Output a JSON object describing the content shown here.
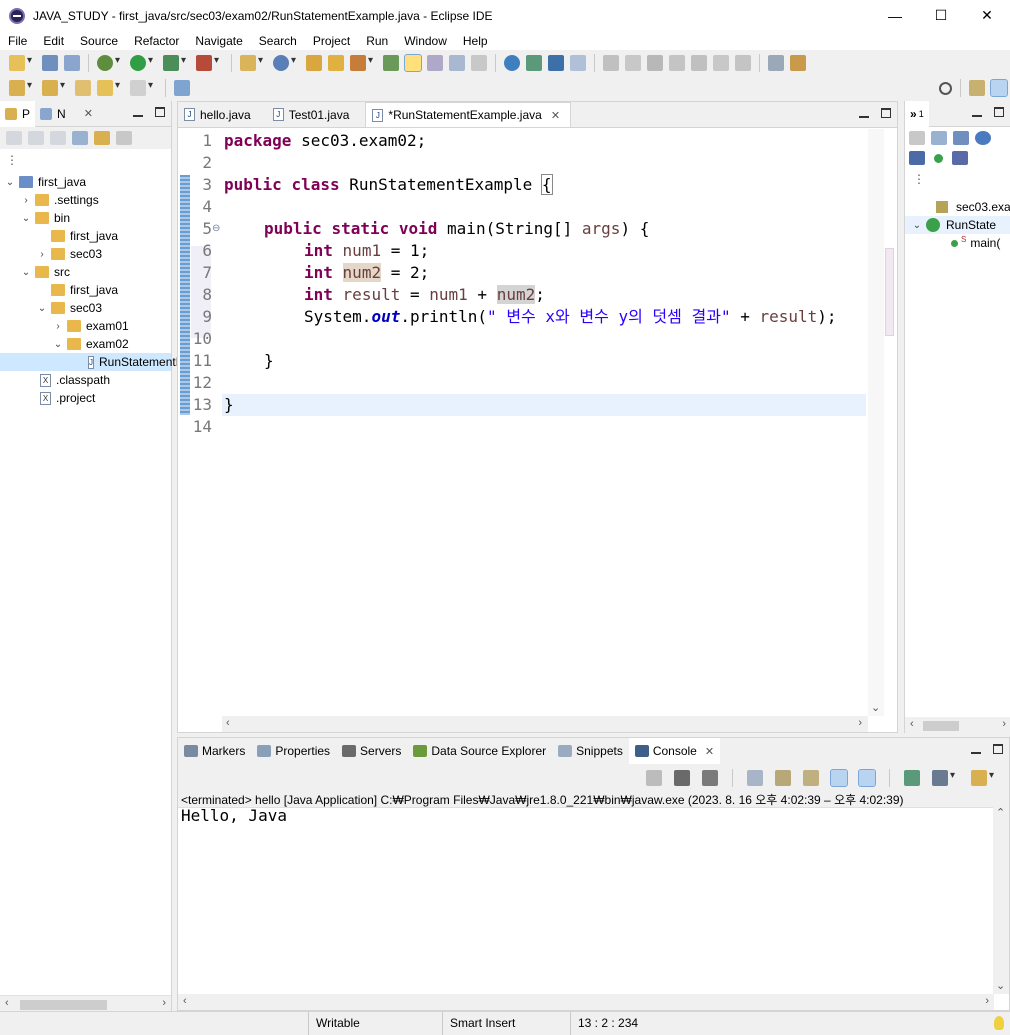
{
  "window": {
    "title": "JAVA_STUDY - first_java/src/sec03/exam02/RunStatementExample.java - Eclipse IDE",
    "controls": {
      "minimize": "—",
      "maximize": "☐",
      "close": "✕"
    }
  },
  "menu": [
    "File",
    "Edit",
    "Source",
    "Refactor",
    "Navigate",
    "Search",
    "Project",
    "Run",
    "Window",
    "Help"
  ],
  "left_view": {
    "tabs": [
      {
        "label": "P"
      },
      {
        "label": "N"
      }
    ],
    "tree": [
      {
        "label": "first_java",
        "level": 0,
        "icon": "project-icon",
        "arrow": "⌄"
      },
      {
        "label": ".settings",
        "level": 1,
        "icon": "folder-icon",
        "arrow": "›"
      },
      {
        "label": "bin",
        "level": 1,
        "icon": "folder-icon",
        "arrow": "⌄"
      },
      {
        "label": "first_java",
        "level": 2,
        "icon": "folder-icon",
        "arrow": ""
      },
      {
        "label": "sec03",
        "level": 2,
        "icon": "folder-icon",
        "arrow": "›"
      },
      {
        "label": "src",
        "level": 1,
        "icon": "folder-icon",
        "arrow": "⌄"
      },
      {
        "label": "first_java",
        "level": 2,
        "icon": "folder-icon",
        "arrow": ""
      },
      {
        "label": "sec03",
        "level": 2,
        "icon": "folder-icon",
        "arrow": "⌄"
      },
      {
        "label": "exam01",
        "level": 3,
        "icon": "folder-icon",
        "arrow": "›"
      },
      {
        "label": "exam02",
        "level": 3,
        "icon": "folder-icon",
        "arrow": "⌄"
      },
      {
        "label": "RunStatementExample.java",
        "level": 4,
        "icon": "java-file-icon",
        "arrow": "",
        "selected": true
      },
      {
        "label": ".classpath",
        "level": 1,
        "icon": "xml-file-icon",
        "arrow": ""
      },
      {
        "label": ".project",
        "level": 1,
        "icon": "xml-file-icon",
        "arrow": ""
      }
    ]
  },
  "editor": {
    "tabs": [
      {
        "label": "hello.java",
        "active": false
      },
      {
        "label": "Test01.java",
        "active": false
      },
      {
        "label": "*RunStatementExample.java",
        "active": true
      }
    ],
    "line_numbers": [
      "1",
      "2",
      "3",
      "4",
      "5",
      "6",
      "7",
      "8",
      "9",
      "10",
      "11",
      "12",
      "13",
      "14"
    ],
    "code": {
      "l1_kw": "package",
      "l1_rest": " sec03.exam02;",
      "l3_kw1": "public",
      "l3_kw2": "class",
      "l3_name": " RunStatementExample ",
      "l3_brace": "{",
      "l5_kw1": "public",
      "l5_kw2": "static",
      "l5_kw3": "void",
      "l5_a": " main(String[] ",
      "l5_arg": "args",
      "l5_b": ") {",
      "l6_kw": "int",
      "l6_var": "num1",
      "l6_rest": " = 1;",
      "l7_kw": "int",
      "l7_var": "num2",
      "l7_rest": " = 2;",
      "l8_kw": "int",
      "l8_var": "result",
      "l8_eq": " = ",
      "l8_v1": "num1",
      "l8_plus": " + ",
      "l8_v2": "num2",
      "l8_end": ";",
      "l9_a": "System.",
      "l9_out": "out",
      "l9_b": ".println(",
      "l9_str": "\" 변수 x와 변수 y의 덧셈 결과\"",
      "l9_plus": " + ",
      "l9_var": "result",
      "l9_end": ");",
      "l11": "}",
      "l13": "}"
    }
  },
  "outline": {
    "items": [
      {
        "label": "sec03.exa"
      },
      {
        "label": "RunState"
      },
      {
        "label": "main("
      }
    ]
  },
  "console": {
    "tabs": [
      {
        "label": "Markers",
        "active": false
      },
      {
        "label": "Properties",
        "active": false
      },
      {
        "label": "Servers",
        "active": false
      },
      {
        "label": "Data Source Explorer",
        "active": false
      },
      {
        "label": "Snippets",
        "active": false
      },
      {
        "label": "Console",
        "active": true
      }
    ],
    "process_line": "<terminated> hello [Java Application] C:₩Program Files₩Java₩jre1.8.0_221₩bin₩javaw.exe  (2023. 8. 16 오후 4:02:39 – 오후 4:02:39)",
    "output": "Hello, Java"
  },
  "status_bar": {
    "writable": "Writable",
    "insert_mode": "Smart Insert",
    "position": "13 : 2 : 234"
  }
}
